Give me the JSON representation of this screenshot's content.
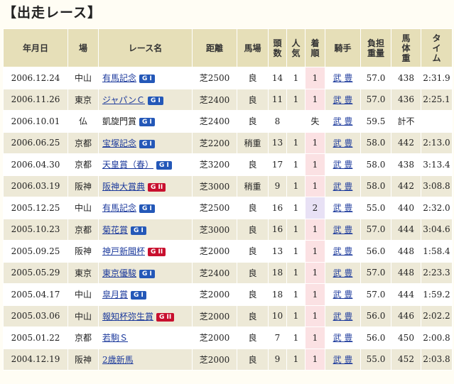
{
  "title": "【出走レース】",
  "headers": {
    "date": "年月日",
    "venue": "場",
    "race": "レース名",
    "distance": "距離",
    "track": "馬場",
    "runners": "頭\n数",
    "popularity": "人\n気",
    "finish": "着\n順",
    "jockey": "騎手",
    "weight": "負担\n重量",
    "horse_weight": "馬\n体\n重",
    "time": "タ\nイ\nム"
  },
  "colors": {
    "G I": "#2458b8",
    "G II": "#c8102e"
  },
  "rows": [
    {
      "date": "2006.12.24",
      "venue": "中山",
      "race": "有馬記念",
      "grade": "G I",
      "gclass": "g1",
      "link": true,
      "distance": "芝2500",
      "track": "良",
      "runners": "14",
      "popularity": "1",
      "finish": "1",
      "fclass": "pos",
      "jockey": "武 豊",
      "weight": "57.0",
      "horse_weight": "438",
      "time": "2:31.9"
    },
    {
      "date": "2006.11.26",
      "venue": "東京",
      "race": "ジャパンＣ",
      "grade": "G I",
      "gclass": "g1",
      "link": true,
      "distance": "芝2400",
      "track": "良",
      "runners": "11",
      "popularity": "1",
      "finish": "1",
      "fclass": "pos",
      "jockey": "武 豊",
      "weight": "57.0",
      "horse_weight": "436",
      "time": "2:25.1"
    },
    {
      "date": "2006.10.01",
      "venue": "仏",
      "race": "凱旋門賞",
      "grade": "G I",
      "gclass": "g1",
      "link": false,
      "distance": "芝2400",
      "track": "良",
      "runners": "8",
      "popularity": "",
      "finish": "失",
      "fclass": "",
      "jockey": "武 豊",
      "weight": "59.5",
      "horse_weight": "計不",
      "time": ""
    },
    {
      "date": "2006.06.25",
      "venue": "京都",
      "race": "宝塚記念",
      "grade": "G I",
      "gclass": "g1",
      "link": true,
      "distance": "芝2200",
      "track": "稍重",
      "runners": "13",
      "popularity": "1",
      "finish": "1",
      "fclass": "pos",
      "jockey": "武 豊",
      "weight": "58.0",
      "horse_weight": "442",
      "time": "2:13.0"
    },
    {
      "date": "2006.04.30",
      "venue": "京都",
      "race": "天皇賞（春）",
      "grade": "G I",
      "gclass": "g1",
      "link": true,
      "distance": "芝3200",
      "track": "良",
      "runners": "17",
      "popularity": "1",
      "finish": "1",
      "fclass": "pos",
      "jockey": "武 豊",
      "weight": "58.0",
      "horse_weight": "438",
      "time": "3:13.4"
    },
    {
      "date": "2006.03.19",
      "venue": "阪神",
      "race": "阪神大賞典",
      "grade": "G II",
      "gclass": "g2",
      "link": true,
      "distance": "芝3000",
      "track": "稍重",
      "runners": "9",
      "popularity": "1",
      "finish": "1",
      "fclass": "pos",
      "jockey": "武 豊",
      "weight": "58.0",
      "horse_weight": "442",
      "time": "3:08.8"
    },
    {
      "date": "2005.12.25",
      "venue": "中山",
      "race": "有馬記念",
      "grade": "G I",
      "gclass": "g1",
      "link": true,
      "distance": "芝2500",
      "track": "良",
      "runners": "16",
      "popularity": "1",
      "finish": "2",
      "fclass": "pos2",
      "jockey": "武 豊",
      "weight": "55.0",
      "horse_weight": "440",
      "time": "2:32.0"
    },
    {
      "date": "2005.10.23",
      "venue": "京都",
      "race": "菊花賞",
      "grade": "G I",
      "gclass": "g1",
      "link": true,
      "distance": "芝3000",
      "track": "良",
      "runners": "16",
      "popularity": "1",
      "finish": "1",
      "fclass": "pos",
      "jockey": "武 豊",
      "weight": "57.0",
      "horse_weight": "444",
      "time": "3:04.6"
    },
    {
      "date": "2005.09.25",
      "venue": "阪神",
      "race": "神戸新聞杯",
      "grade": "G II",
      "gclass": "g2",
      "link": true,
      "distance": "芝2000",
      "track": "良",
      "runners": "13",
      "popularity": "1",
      "finish": "1",
      "fclass": "pos",
      "jockey": "武 豊",
      "weight": "56.0",
      "horse_weight": "448",
      "time": "1:58.4"
    },
    {
      "date": "2005.05.29",
      "venue": "東京",
      "race": "東京優駿",
      "grade": "G I",
      "gclass": "g1",
      "link": true,
      "distance": "芝2400",
      "track": "良",
      "runners": "18",
      "popularity": "1",
      "finish": "1",
      "fclass": "pos",
      "jockey": "武 豊",
      "weight": "57.0",
      "horse_weight": "448",
      "time": "2:23.3"
    },
    {
      "date": "2005.04.17",
      "venue": "中山",
      "race": "皐月賞",
      "grade": "G I",
      "gclass": "g1",
      "link": true,
      "distance": "芝2000",
      "track": "良",
      "runners": "18",
      "popularity": "1",
      "finish": "1",
      "fclass": "pos",
      "jockey": "武 豊",
      "weight": "57.0",
      "horse_weight": "444",
      "time": "1:59.2"
    },
    {
      "date": "2005.03.06",
      "venue": "中山",
      "race": "報知杯弥生賞",
      "grade": "G II",
      "gclass": "g2",
      "link": true,
      "distance": "芝2000",
      "track": "良",
      "runners": "10",
      "popularity": "1",
      "finish": "1",
      "fclass": "pos",
      "jockey": "武 豊",
      "weight": "56.0",
      "horse_weight": "446",
      "time": "2:02.2"
    },
    {
      "date": "2005.01.22",
      "venue": "京都",
      "race": "若駒Ｓ",
      "grade": "",
      "gclass": "",
      "link": true,
      "distance": "芝2000",
      "track": "良",
      "runners": "7",
      "popularity": "1",
      "finish": "1",
      "fclass": "pos",
      "jockey": "武 豊",
      "weight": "56.0",
      "horse_weight": "450",
      "time": "2:00.8"
    },
    {
      "date": "2004.12.19",
      "venue": "阪神",
      "race": "2歳新馬",
      "grade": "",
      "gclass": "",
      "link": true,
      "distance": "芝2000",
      "track": "良",
      "runners": "9",
      "popularity": "1",
      "finish": "1",
      "fclass": "pos",
      "jockey": "武 豊",
      "weight": "55.0",
      "horse_weight": "452",
      "time": "2:03.8"
    }
  ]
}
